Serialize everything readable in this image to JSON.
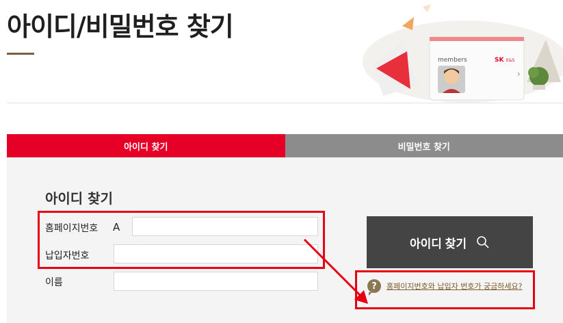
{
  "header": {
    "title": "아이디/비밀번호 찾기"
  },
  "hero": {
    "card_label": "members",
    "brand_text": "SK",
    "brand_sub": "E&S"
  },
  "tabs": [
    {
      "label": "아이디 찾기",
      "active": true
    },
    {
      "label": "비밀번호 찾기",
      "active": false
    }
  ],
  "form": {
    "section_title": "아이디 찾기",
    "fields": {
      "homepage_number": {
        "label": "홈페이지번호",
        "prefix": "A",
        "value": ""
      },
      "payer_number": {
        "label": "납입자번호",
        "value": ""
      },
      "name": {
        "label": "이름",
        "value": ""
      }
    },
    "submit_label": "아이디 찾기",
    "help_link": "홈페이지번호와 납입자 번호가 궁금하세요?"
  },
  "colors": {
    "accent": "#e60028",
    "inactive_tab": "#8c8c8c",
    "button": "#444444",
    "annotation": "#e60012",
    "help": "#8b7751"
  },
  "icons": {
    "search": "search-icon",
    "help": "question-icon"
  }
}
